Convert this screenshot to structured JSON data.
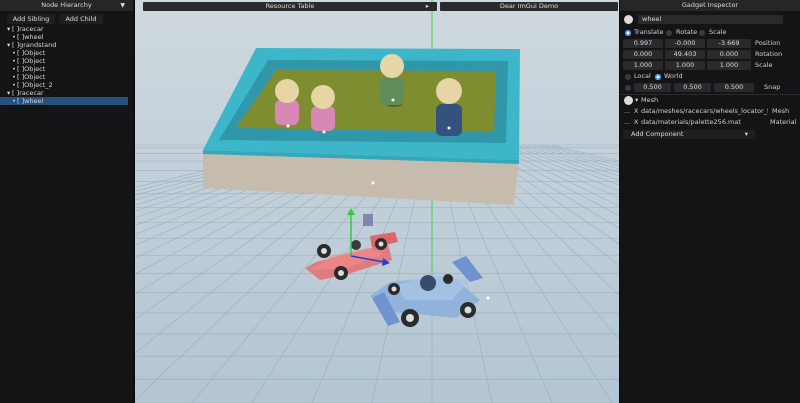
{
  "hierarchy": {
    "title": "Node Hierarchy",
    "add_sibling": "Add Sibling",
    "add_child": "Add Child",
    "tree": [
      {
        "toggle": "▾",
        "text": "[ ]racecar"
      },
      {
        "toggle": "•",
        "text": "[ ]wheel"
      },
      {
        "toggle": "▾",
        "text": "[ ]grandstand"
      },
      {
        "toggle": "•",
        "text": "[ ]Object"
      },
      {
        "toggle": "•",
        "text": "[ ]Object"
      },
      {
        "toggle": "•",
        "text": "[ ]Object"
      },
      {
        "toggle": "•",
        "text": "[ ]Object"
      },
      {
        "toggle": "•",
        "text": "[ ]Object_2"
      },
      {
        "toggle": "▾",
        "text": "[ ]racecar"
      },
      {
        "toggle": "•",
        "text": "[ ]wheel"
      }
    ]
  },
  "top_tabs": {
    "resource_table": "Resource Table",
    "resource_arrow": "▸",
    "demo": "Dear ImGui Demo"
  },
  "inspector": {
    "title": "Gadget Inspector",
    "name_value": "wheel",
    "modes": [
      "Translate",
      "Rotate",
      "Scale"
    ],
    "position": {
      "x": "0.997",
      "y": "-0.000",
      "z": "-3.669",
      "label": "Position"
    },
    "rotation": {
      "x": "0.000",
      "y": "49.403",
      "z": "0.000",
      "label": "Rotation"
    },
    "scale": {
      "x": "1.000",
      "y": "1.000",
      "z": "1.000",
      "label": "Scale"
    },
    "space": {
      "local": "Local",
      "world": "World"
    },
    "snap": {
      "x": "0.500",
      "y": "0.500",
      "z": "0.500",
      "label": "Snap"
    },
    "mesh_header": "Mesh",
    "mesh_triangle": "▾",
    "mesh_path": "data/meshes/racecars/wheels_locator_fancy.",
    "mesh_label": "Mesh",
    "material_path": "data/materials/palette256.mat",
    "material_label": "Material",
    "ellipsis": "...",
    "clear_x": "X",
    "add_component": "Add Component",
    "add_component_arrow": "▾"
  },
  "colors": {
    "accent": "#3b8ee6",
    "selection": "#26507e",
    "box_rim": "#3bb9cc",
    "box_floor": "#7c8a2e",
    "box_base": "#c9bfb0",
    "red_car": "#e06a6a",
    "blue_car": "#7aa2d6",
    "gizmo_green": "#2ecc40"
  }
}
